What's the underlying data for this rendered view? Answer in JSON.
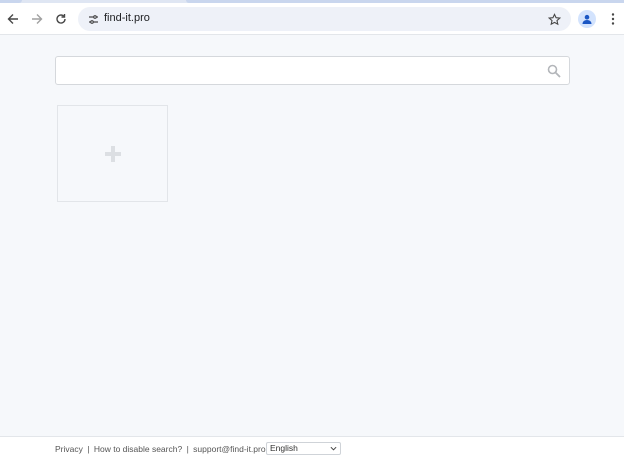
{
  "browser": {
    "url": "find-it.pro",
    "back_icon": "arrow-left-icon",
    "forward_icon": "arrow-right-icon",
    "reload_icon": "reload-icon",
    "site_info_icon": "tune-icon",
    "bookmark_icon": "star-icon",
    "profile_icon": "person-icon",
    "menu_icon": "kebab-menu-icon"
  },
  "search": {
    "placeholder": "",
    "value": "",
    "icon": "search-icon"
  },
  "tiles": [
    {
      "type": "add",
      "icon": "plus-icon"
    }
  ],
  "footer": {
    "privacy": "Privacy",
    "how_to_disable": "How to disable search?",
    "support_email": "support@find-it.pro",
    "separator": "|",
    "language": "English"
  },
  "colors": {
    "page_bg": "#f6f8fb",
    "omnibox_bg": "#eef1f8",
    "avatar_bg": "#d3e3fd",
    "avatar_fg": "#1a56c4"
  }
}
